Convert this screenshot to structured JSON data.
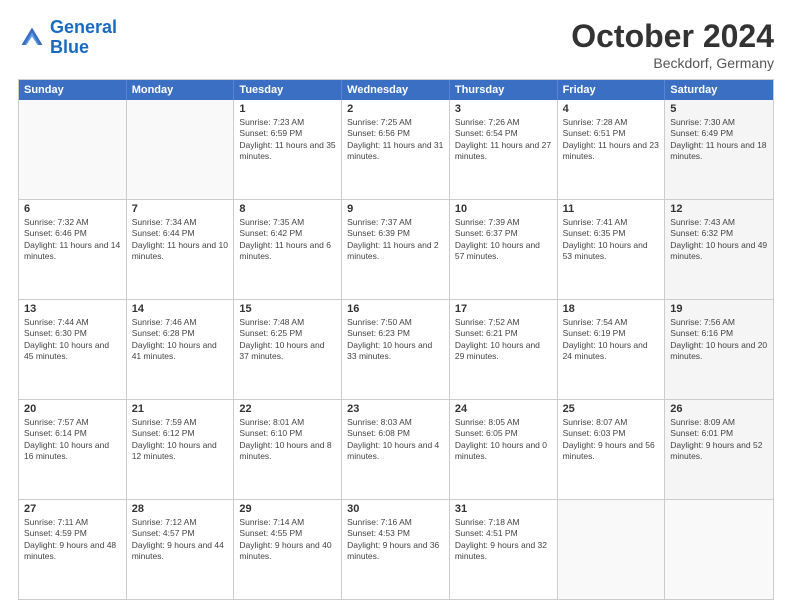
{
  "header": {
    "logo_general": "General",
    "logo_blue": "Blue",
    "month_title": "October 2024",
    "location": "Beckdorf, Germany"
  },
  "weekdays": [
    "Sunday",
    "Monday",
    "Tuesday",
    "Wednesday",
    "Thursday",
    "Friday",
    "Saturday"
  ],
  "rows": [
    [
      {
        "day": "",
        "sunrise": "",
        "sunset": "",
        "daylight": "",
        "empty": true
      },
      {
        "day": "",
        "sunrise": "",
        "sunset": "",
        "daylight": "",
        "empty": true
      },
      {
        "day": "1",
        "sunrise": "Sunrise: 7:23 AM",
        "sunset": "Sunset: 6:59 PM",
        "daylight": "Daylight: 11 hours and 35 minutes."
      },
      {
        "day": "2",
        "sunrise": "Sunrise: 7:25 AM",
        "sunset": "Sunset: 6:56 PM",
        "daylight": "Daylight: 11 hours and 31 minutes."
      },
      {
        "day": "3",
        "sunrise": "Sunrise: 7:26 AM",
        "sunset": "Sunset: 6:54 PM",
        "daylight": "Daylight: 11 hours and 27 minutes."
      },
      {
        "day": "4",
        "sunrise": "Sunrise: 7:28 AM",
        "sunset": "Sunset: 6:51 PM",
        "daylight": "Daylight: 11 hours and 23 minutes."
      },
      {
        "day": "5",
        "sunrise": "Sunrise: 7:30 AM",
        "sunset": "Sunset: 6:49 PM",
        "daylight": "Daylight: 11 hours and 18 minutes.",
        "shade": true
      }
    ],
    [
      {
        "day": "6",
        "sunrise": "Sunrise: 7:32 AM",
        "sunset": "Sunset: 6:46 PM",
        "daylight": "Daylight: 11 hours and 14 minutes."
      },
      {
        "day": "7",
        "sunrise": "Sunrise: 7:34 AM",
        "sunset": "Sunset: 6:44 PM",
        "daylight": "Daylight: 11 hours and 10 minutes."
      },
      {
        "day": "8",
        "sunrise": "Sunrise: 7:35 AM",
        "sunset": "Sunset: 6:42 PM",
        "daylight": "Daylight: 11 hours and 6 minutes."
      },
      {
        "day": "9",
        "sunrise": "Sunrise: 7:37 AM",
        "sunset": "Sunset: 6:39 PM",
        "daylight": "Daylight: 11 hours and 2 minutes."
      },
      {
        "day": "10",
        "sunrise": "Sunrise: 7:39 AM",
        "sunset": "Sunset: 6:37 PM",
        "daylight": "Daylight: 10 hours and 57 minutes."
      },
      {
        "day": "11",
        "sunrise": "Sunrise: 7:41 AM",
        "sunset": "Sunset: 6:35 PM",
        "daylight": "Daylight: 10 hours and 53 minutes."
      },
      {
        "day": "12",
        "sunrise": "Sunrise: 7:43 AM",
        "sunset": "Sunset: 6:32 PM",
        "daylight": "Daylight: 10 hours and 49 minutes.",
        "shade": true
      }
    ],
    [
      {
        "day": "13",
        "sunrise": "Sunrise: 7:44 AM",
        "sunset": "Sunset: 6:30 PM",
        "daylight": "Daylight: 10 hours and 45 minutes."
      },
      {
        "day": "14",
        "sunrise": "Sunrise: 7:46 AM",
        "sunset": "Sunset: 6:28 PM",
        "daylight": "Daylight: 10 hours and 41 minutes."
      },
      {
        "day": "15",
        "sunrise": "Sunrise: 7:48 AM",
        "sunset": "Sunset: 6:25 PM",
        "daylight": "Daylight: 10 hours and 37 minutes."
      },
      {
        "day": "16",
        "sunrise": "Sunrise: 7:50 AM",
        "sunset": "Sunset: 6:23 PM",
        "daylight": "Daylight: 10 hours and 33 minutes."
      },
      {
        "day": "17",
        "sunrise": "Sunrise: 7:52 AM",
        "sunset": "Sunset: 6:21 PM",
        "daylight": "Daylight: 10 hours and 29 minutes."
      },
      {
        "day": "18",
        "sunrise": "Sunrise: 7:54 AM",
        "sunset": "Sunset: 6:19 PM",
        "daylight": "Daylight: 10 hours and 24 minutes."
      },
      {
        "day": "19",
        "sunrise": "Sunrise: 7:56 AM",
        "sunset": "Sunset: 6:16 PM",
        "daylight": "Daylight: 10 hours and 20 minutes.",
        "shade": true
      }
    ],
    [
      {
        "day": "20",
        "sunrise": "Sunrise: 7:57 AM",
        "sunset": "Sunset: 6:14 PM",
        "daylight": "Daylight: 10 hours and 16 minutes."
      },
      {
        "day": "21",
        "sunrise": "Sunrise: 7:59 AM",
        "sunset": "Sunset: 6:12 PM",
        "daylight": "Daylight: 10 hours and 12 minutes."
      },
      {
        "day": "22",
        "sunrise": "Sunrise: 8:01 AM",
        "sunset": "Sunset: 6:10 PM",
        "daylight": "Daylight: 10 hours and 8 minutes."
      },
      {
        "day": "23",
        "sunrise": "Sunrise: 8:03 AM",
        "sunset": "Sunset: 6:08 PM",
        "daylight": "Daylight: 10 hours and 4 minutes."
      },
      {
        "day": "24",
        "sunrise": "Sunrise: 8:05 AM",
        "sunset": "Sunset: 6:05 PM",
        "daylight": "Daylight: 10 hours and 0 minutes."
      },
      {
        "day": "25",
        "sunrise": "Sunrise: 8:07 AM",
        "sunset": "Sunset: 6:03 PM",
        "daylight": "Daylight: 9 hours and 56 minutes."
      },
      {
        "day": "26",
        "sunrise": "Sunrise: 8:09 AM",
        "sunset": "Sunset: 6:01 PM",
        "daylight": "Daylight: 9 hours and 52 minutes.",
        "shade": true
      }
    ],
    [
      {
        "day": "27",
        "sunrise": "Sunrise: 7:11 AM",
        "sunset": "Sunset: 4:59 PM",
        "daylight": "Daylight: 9 hours and 48 minutes."
      },
      {
        "day": "28",
        "sunrise": "Sunrise: 7:12 AM",
        "sunset": "Sunset: 4:57 PM",
        "daylight": "Daylight: 9 hours and 44 minutes."
      },
      {
        "day": "29",
        "sunrise": "Sunrise: 7:14 AM",
        "sunset": "Sunset: 4:55 PM",
        "daylight": "Daylight: 9 hours and 40 minutes."
      },
      {
        "day": "30",
        "sunrise": "Sunrise: 7:16 AM",
        "sunset": "Sunset: 4:53 PM",
        "daylight": "Daylight: 9 hours and 36 minutes."
      },
      {
        "day": "31",
        "sunrise": "Sunrise: 7:18 AM",
        "sunset": "Sunset: 4:51 PM",
        "daylight": "Daylight: 9 hours and 32 minutes."
      },
      {
        "day": "",
        "sunrise": "",
        "sunset": "",
        "daylight": "",
        "empty": true
      },
      {
        "day": "",
        "sunrise": "",
        "sunset": "",
        "daylight": "",
        "empty": true,
        "shade": true
      }
    ]
  ]
}
